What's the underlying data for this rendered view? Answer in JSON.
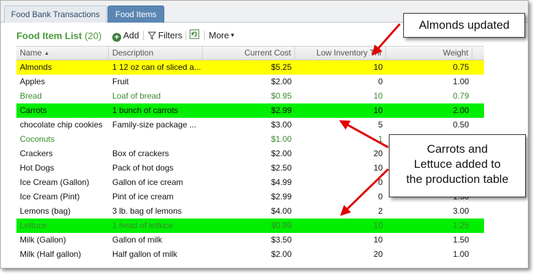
{
  "tabs": [
    {
      "label": "Food Bank Transactions",
      "active": false
    },
    {
      "label": "Food Items",
      "active": true
    }
  ],
  "toolbar": {
    "title": "Food Item List",
    "count": "(20)",
    "add_label": "Add",
    "filters_label": "Filters",
    "more_label": "More"
  },
  "columns": [
    "Name",
    "Description",
    "Current Cost",
    "Low Inventory Thr",
    "Weight"
  ],
  "rows": [
    {
      "name": "Almonds",
      "description": "1 12 oz can of sliced a...",
      "cost": "$5.25",
      "low": "10",
      "weight": "0.75",
      "style": "hl-yellow"
    },
    {
      "name": "Apples",
      "description": "Fruit",
      "cost": "$2.00",
      "low": "0",
      "weight": "1.00",
      "style": ""
    },
    {
      "name": "Bread",
      "description": "Loaf of bread",
      "cost": "$0.95",
      "low": "10",
      "weight": "0.79",
      "style": "greentext"
    },
    {
      "name": "Carrots",
      "description": "1 bunch of carrots",
      "cost": "$2.99",
      "low": "10",
      "weight": "2.00",
      "style": "hl-green"
    },
    {
      "name": "chocolate chip cookies",
      "description": "Family-size package ...",
      "cost": "$3.00",
      "low": "5",
      "weight": "0.50",
      "style": ""
    },
    {
      "name": "Coconuts",
      "description": "",
      "cost": "$1.00",
      "low": "1",
      "weight": "",
      "style": "greentext"
    },
    {
      "name": "Crackers",
      "description": "Box of crackers",
      "cost": "$2.00",
      "low": "20",
      "weight": "",
      "style": ""
    },
    {
      "name": "Hot Dogs",
      "description": "Pack of hot dogs",
      "cost": "$2.50",
      "low": "10",
      "weight": "",
      "style": ""
    },
    {
      "name": "Ice Cream (Gallon)",
      "description": "Gallon of ice cream",
      "cost": "$4.99",
      "low": "0",
      "weight": "",
      "style": ""
    },
    {
      "name": "Ice Cream (Pint)",
      "description": "Pint of ice cream",
      "cost": "$2.99",
      "low": "0",
      "weight": "1.50",
      "style": ""
    },
    {
      "name": "Lemons (bag)",
      "description": "3 lb. bag of lemons",
      "cost": "$4.00",
      "low": "2",
      "weight": "3.00",
      "style": ""
    },
    {
      "name": "Lettuce",
      "description": "1 head of lettuce",
      "cost": "$0.99",
      "low": "10",
      "weight": "1.25",
      "style": "hl-green greentext"
    },
    {
      "name": "Milk (Gallon)",
      "description": "Gallon of milk",
      "cost": "$3.50",
      "low": "10",
      "weight": "1.50",
      "style": ""
    },
    {
      "name": "Milk (Half gallon)",
      "description": "Half gallon of milk",
      "cost": "$2.00",
      "low": "20",
      "weight": "1.00",
      "style": ""
    }
  ],
  "callouts": {
    "almonds": "Almonds updated",
    "carrots_line1": "Carrots and",
    "carrots_line2": "Lettuce added to",
    "carrots_line3": "the production table"
  },
  "colors": {
    "updated_highlight": "#ffff00",
    "added_highlight": "#00ee00",
    "arrow": "#e00000",
    "active_tab": "#5b86b3",
    "title_green": "#4a9a3a"
  }
}
